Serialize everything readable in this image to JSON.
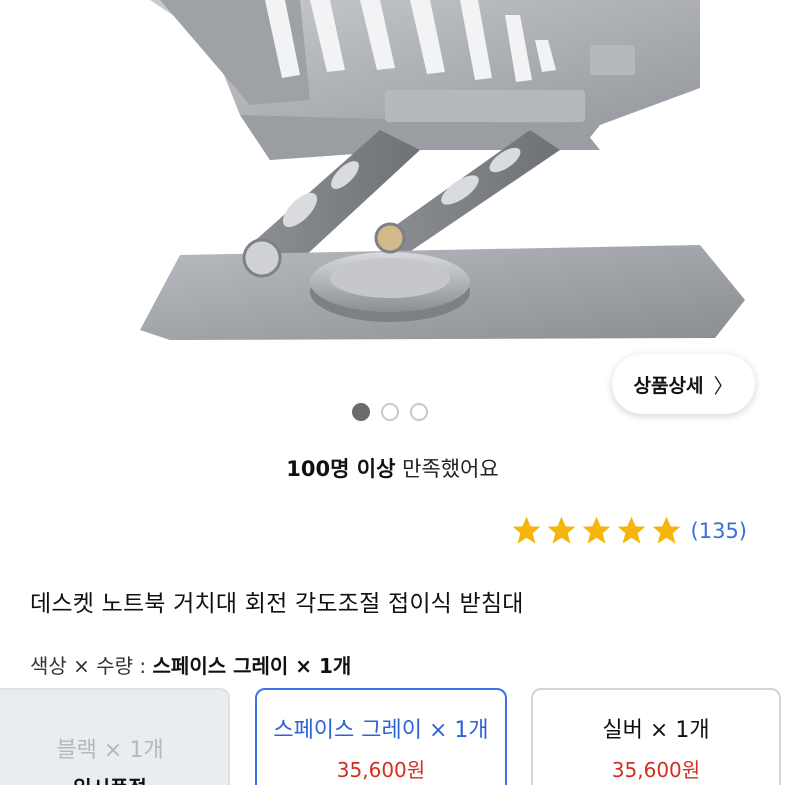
{
  "hero": {
    "image_alt": "laptop-stand-product-photo"
  },
  "detail_button": {
    "label": "상품상세",
    "chevron": "〉"
  },
  "carousel": {
    "total": 3,
    "active": 0
  },
  "satisfaction": {
    "bold": "100명 이상",
    "rest": " 만족했어요"
  },
  "rating": {
    "stars": 5,
    "count": "(135)",
    "star_color": "#f5b50a"
  },
  "product": {
    "title": "데스켓 노트북 거치대 회전 각도조절 접이식 받침대"
  },
  "option_summary": {
    "label": "색상 × 수량 : ",
    "value": "스페이스 그레이 × 1개"
  },
  "options": [
    {
      "name": "블랙 × 1개",
      "status": "일시품절"
    },
    {
      "name": "스페이스 그레이 × 1개",
      "price": "35,600원"
    },
    {
      "name": "실버 × 1개",
      "price": "35,600원"
    }
  ],
  "colors": {
    "accent": "#3d72e8",
    "price": "#d32f1e",
    "link": "#3a6fd8"
  }
}
